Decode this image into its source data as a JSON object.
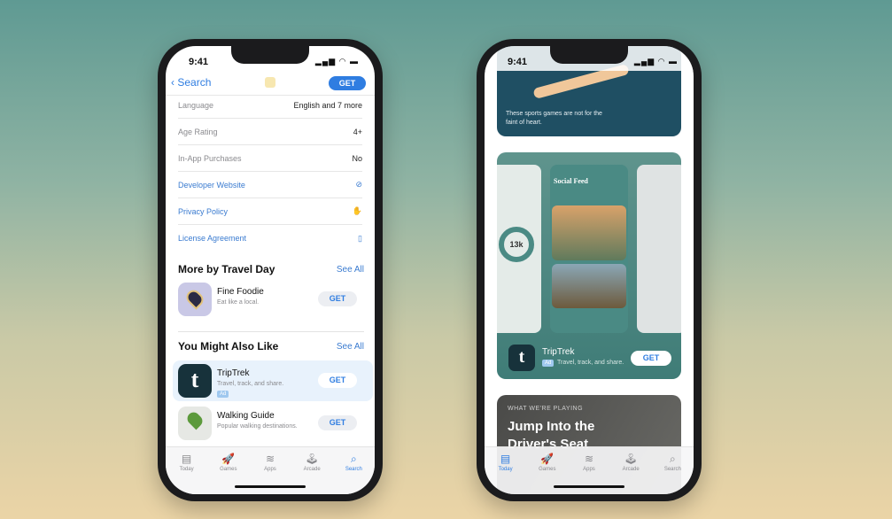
{
  "status_time": "9:41",
  "left": {
    "nav": {
      "back_label": "Search",
      "get_label": "GET"
    },
    "info_rows": [
      {
        "label": "Language",
        "value": "English and 7 more"
      },
      {
        "label": "Age Rating",
        "value": "4+"
      },
      {
        "label": "In-App Purchases",
        "value": "No"
      }
    ],
    "link_rows": [
      {
        "label": "Developer Website",
        "icon": "compass-icon"
      },
      {
        "label": "Privacy Policy",
        "icon": "hand-icon"
      },
      {
        "label": "License Agreement",
        "icon": "document-icon"
      }
    ],
    "more_by": {
      "title": "More by Travel Day",
      "see_all": "See All",
      "apps": [
        {
          "name": "Fine Foodie",
          "subtitle": "Eat like a local.",
          "get": "GET"
        }
      ]
    },
    "also_like": {
      "title": "You Might Also Like",
      "see_all": "See All",
      "apps": [
        {
          "name": "TripTrek",
          "subtitle": "Travel, track, and share.",
          "badge": "Ad",
          "get": "GET"
        },
        {
          "name": "Walking Guide",
          "subtitle": "Popular walking destinations.",
          "get": "GET"
        }
      ]
    },
    "active_tab": "Search"
  },
  "right": {
    "card1_text": "These sports games are not for the faint of heart.",
    "promo": {
      "feed_title": "Social Feed",
      "stat": "13k",
      "app_name": "TripTrek",
      "badge": "Ad",
      "subtitle": "Travel, track, and share.",
      "get": "GET"
    },
    "story": {
      "eyebrow": "WHAT WE'RE PLAYING",
      "title": "Jump Into the Driver's Seat"
    },
    "active_tab": "Today"
  },
  "tabs": [
    {
      "label": "Today",
      "icon": "today-icon",
      "glyph": "▤"
    },
    {
      "label": "Games",
      "icon": "rocket-icon",
      "glyph": "🚀"
    },
    {
      "label": "Apps",
      "icon": "layers-icon",
      "glyph": "≋"
    },
    {
      "label": "Arcade",
      "icon": "joystick-icon",
      "glyph": "🕹"
    },
    {
      "label": "Search",
      "icon": "search-icon",
      "glyph": "⌕"
    }
  ],
  "colors": {
    "accent": "#2f7de1",
    "teal": "#4a8a84",
    "navy": "#1f4f63"
  }
}
